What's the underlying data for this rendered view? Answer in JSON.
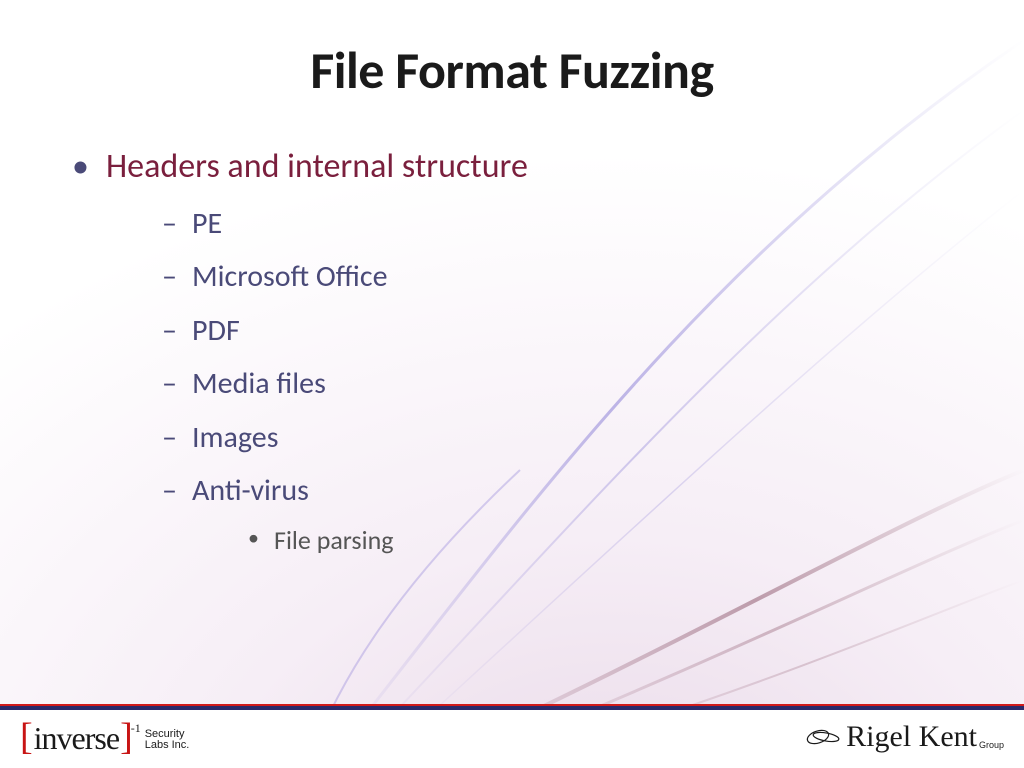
{
  "slide": {
    "title": "File Format Fuzzing",
    "bullets": [
      {
        "text": "Headers and internal structure",
        "children": [
          {
            "text": "PE"
          },
          {
            "text": "Microsoft Office"
          },
          {
            "text": "PDF"
          },
          {
            "text": "Media files"
          },
          {
            "text": "Images"
          },
          {
            "text": "Anti-virus",
            "children": [
              {
                "text": "File parsing"
              }
            ]
          }
        ]
      }
    ]
  },
  "footer": {
    "left": {
      "brand": "inverse",
      "exponent": "-1",
      "line1": "Security",
      "line2": "Labs Inc."
    },
    "right": {
      "name": "Rigel Kent",
      "sub": "Group"
    }
  },
  "colors": {
    "title": "#1a1a1a",
    "bullet_primary": "#7a1f3d",
    "bullet_secondary": "#4a4a78",
    "bullet_tertiary": "#555555",
    "stripe_red": "#d11a1a",
    "stripe_blue": "#2a2a6a",
    "bracket": "#c81414"
  }
}
